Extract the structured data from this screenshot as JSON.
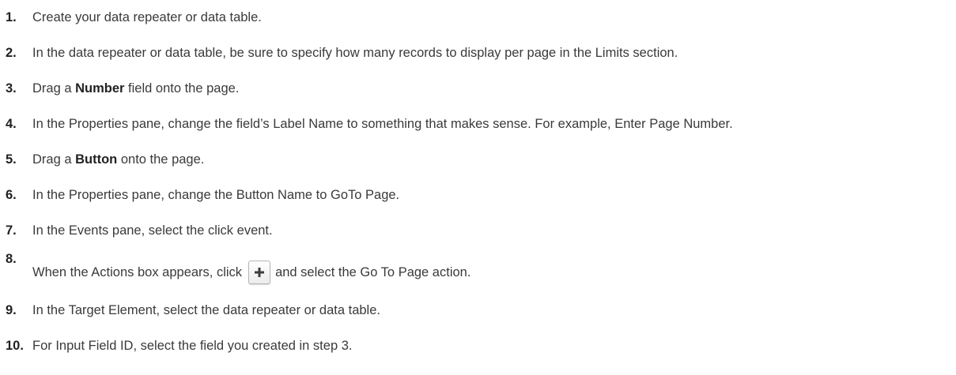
{
  "steps": [
    {
      "num": "1.",
      "text": "Create your data repeater or data table."
    },
    {
      "num": "2.",
      "text": "In the data repeater or data table, be sure to specify how many records to display per page in the Limits section."
    },
    {
      "num": "3.",
      "pre": "Drag a ",
      "bold": "Number",
      "post": " field onto the page."
    },
    {
      "num": "4.",
      "text": "In the Properties pane, change the field’s Label Name to something that makes sense. For example, Enter Page Number."
    },
    {
      "num": "5.",
      "pre": "Drag a ",
      "bold": "Button",
      "post": " onto the page."
    },
    {
      "num": "6.",
      "text": "In the Properties pane, change the Button Name to GoTo Page."
    },
    {
      "num": "7.",
      "text": "In the Events pane, select the click event."
    },
    {
      "num": "8.",
      "pre": "When the Actions box appears, click",
      "post": "and select the Go To Page action.",
      "icon": "plus-icon"
    },
    {
      "num": "9.",
      "text": "In the Target Element, select the data repeater or data table."
    },
    {
      "num": "10.",
      "text": "For Input Field ID, select the field you created in step 3."
    }
  ]
}
